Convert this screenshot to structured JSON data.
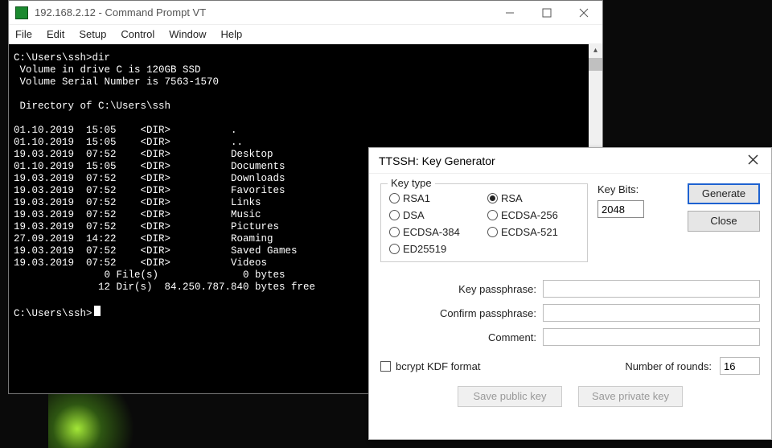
{
  "terminal": {
    "title": "192.168.2.12 - Command Prompt VT",
    "menus": [
      "File",
      "Edit",
      "Setup",
      "Control",
      "Window",
      "Help"
    ],
    "lines": [
      "C:\\Users\\ssh>dir",
      " Volume in drive C is 120GB SSD",
      " Volume Serial Number is 7563-1570",
      "",
      " Directory of C:\\Users\\ssh",
      "",
      "01.10.2019  15:05    <DIR>          .",
      "01.10.2019  15:05    <DIR>          ..",
      "19.03.2019  07:52    <DIR>          Desktop",
      "01.10.2019  15:05    <DIR>          Documents",
      "19.03.2019  07:52    <DIR>          Downloads",
      "19.03.2019  07:52    <DIR>          Favorites",
      "19.03.2019  07:52    <DIR>          Links",
      "19.03.2019  07:52    <DIR>          Music",
      "19.03.2019  07:52    <DIR>          Pictures",
      "27.09.2019  14:22    <DIR>          Roaming",
      "19.03.2019  07:52    <DIR>          Saved Games",
      "19.03.2019  07:52    <DIR>          Videos",
      "               0 File(s)              0 bytes",
      "              12 Dir(s)  84.250.787.840 bytes free",
      "",
      "C:\\Users\\ssh>"
    ]
  },
  "dialog": {
    "title": "TTSSH: Key Generator",
    "group_label": "Key type",
    "radios": [
      "RSA1",
      "RSA",
      "DSA",
      "ECDSA-256",
      "ECDSA-384",
      "ECDSA-521",
      "ED25519"
    ],
    "selected_radio": "RSA",
    "keybits_label": "Key Bits:",
    "keybits_value": "2048",
    "btn_generate": "Generate",
    "btn_close": "Close",
    "passphrase_label": "Key passphrase:",
    "confirm_label": "Confirm passphrase:",
    "comment_label": "Comment:",
    "passphrase_value": "",
    "confirm_value": "",
    "comment_value": "",
    "bcrypt_label": "bcrypt KDF format",
    "bcrypt_checked": false,
    "rounds_label": "Number of rounds:",
    "rounds_value": "16",
    "btn_save_public": "Save public key",
    "btn_save_private": "Save private key"
  }
}
